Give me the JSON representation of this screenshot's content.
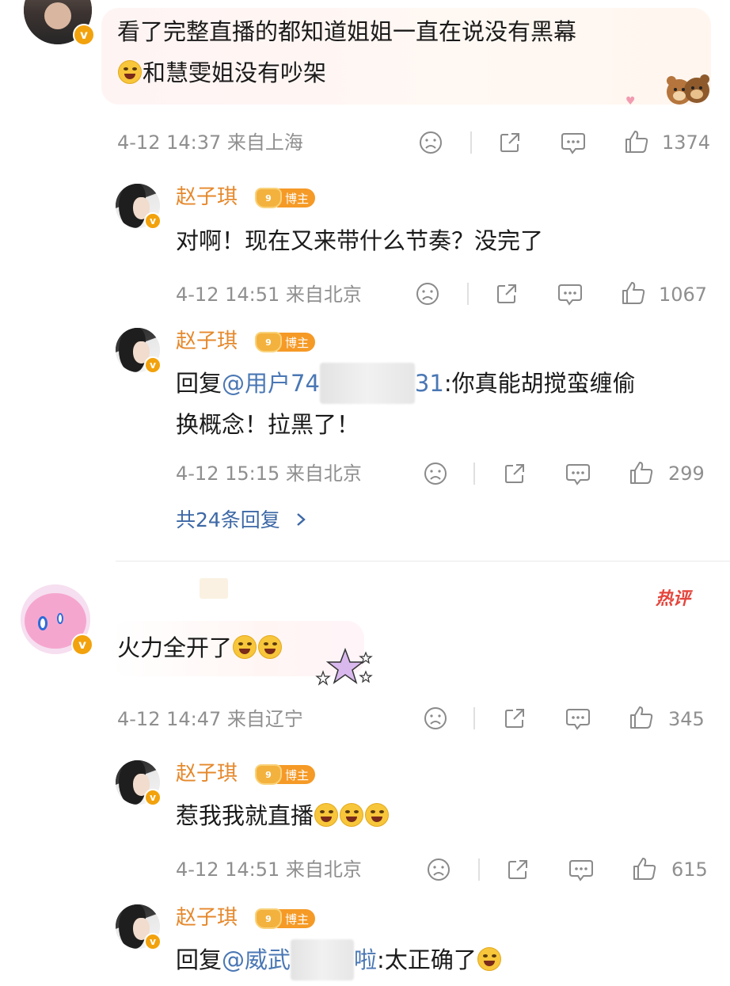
{
  "comment1": {
    "text_line1": "看了完整直播的都知道姐姐一直在说没有黑幕",
    "text_line2": "和慧雯姐没有吵架",
    "time": "4-12 14:37",
    "location": "来自上海",
    "likes": "1374"
  },
  "replies1": [
    {
      "name": "赵子琪",
      "tag": "博主",
      "text": "对啊！现在又来带什么节奏？没完了",
      "time": "4-12 14:51",
      "location": "来自北京",
      "likes": "1067"
    },
    {
      "name": "赵子琪",
      "tag": "博主",
      "reply_prefix": "回复",
      "mention_start": "@用户74",
      "mention_end": "31",
      "text_rest": ":你真能胡搅蛮缠偷",
      "text_line2": "换概念！拉黑了！",
      "time": "4-12 15:15",
      "location": "来自北京",
      "likes": "299"
    }
  ],
  "more_replies": "共24条回复",
  "comment2": {
    "hot_label": "热评",
    "text": "火力全开了",
    "time": "4-12 14:47",
    "location": "来自辽宁",
    "likes": "345"
  },
  "replies2": [
    {
      "name": "赵子琪",
      "tag": "博主",
      "text": "惹我我就直播",
      "time": "4-12 14:51",
      "location": "来自北京",
      "likes": "615"
    },
    {
      "name": "赵子琪",
      "tag": "博主",
      "reply_prefix": "回复",
      "mention_start": "@威武",
      "mention_end": "啦",
      "text_rest": ":太正确了"
    }
  ],
  "badge_letter": "v",
  "crown_letter": "9",
  "colors": {
    "name": "#e5882c",
    "mention": "#4a77b4",
    "meta": "#8f8f8f",
    "tag_bg": "#f59a26",
    "hot": "#e5453c"
  },
  "icons": [
    "dislike-icon",
    "share-icon",
    "comment-icon",
    "like-icon",
    "chevron-right-icon"
  ]
}
